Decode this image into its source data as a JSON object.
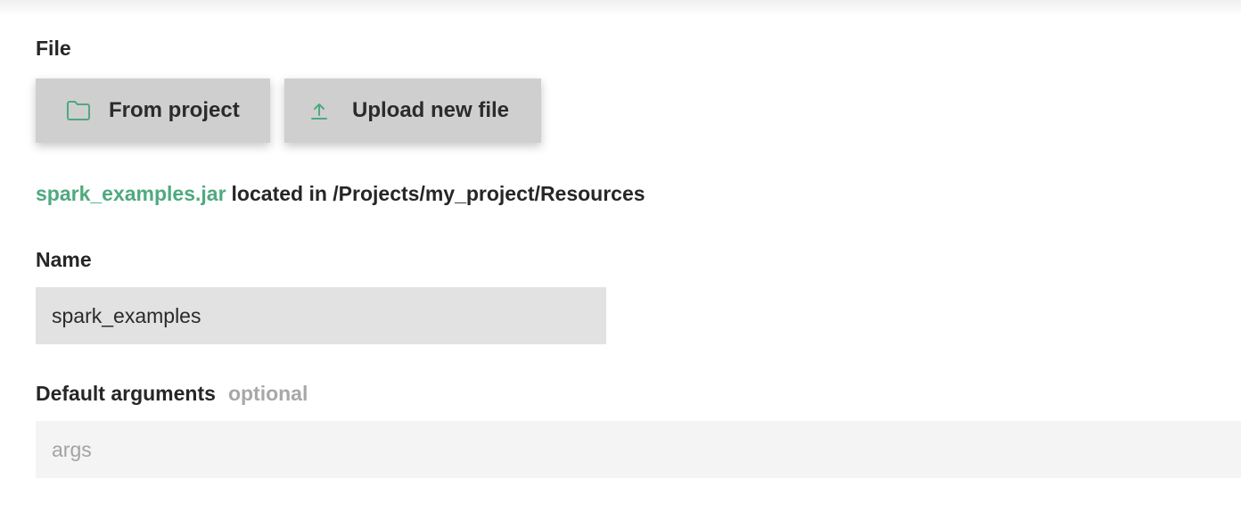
{
  "file_section": {
    "label": "File",
    "from_project_label": "From project",
    "upload_label": "Upload new file",
    "icon_folder": "folder-icon",
    "icon_upload": "upload-icon",
    "accent_color": "#4fa97f"
  },
  "selected_file": {
    "name": "spark_examples.jar",
    "location_text": "located in /Projects/my_project/Resources"
  },
  "name_field": {
    "label": "Name",
    "value": "spark_examples"
  },
  "args_field": {
    "label": "Default arguments",
    "optional_label": "optional",
    "placeholder": "args",
    "value": ""
  }
}
